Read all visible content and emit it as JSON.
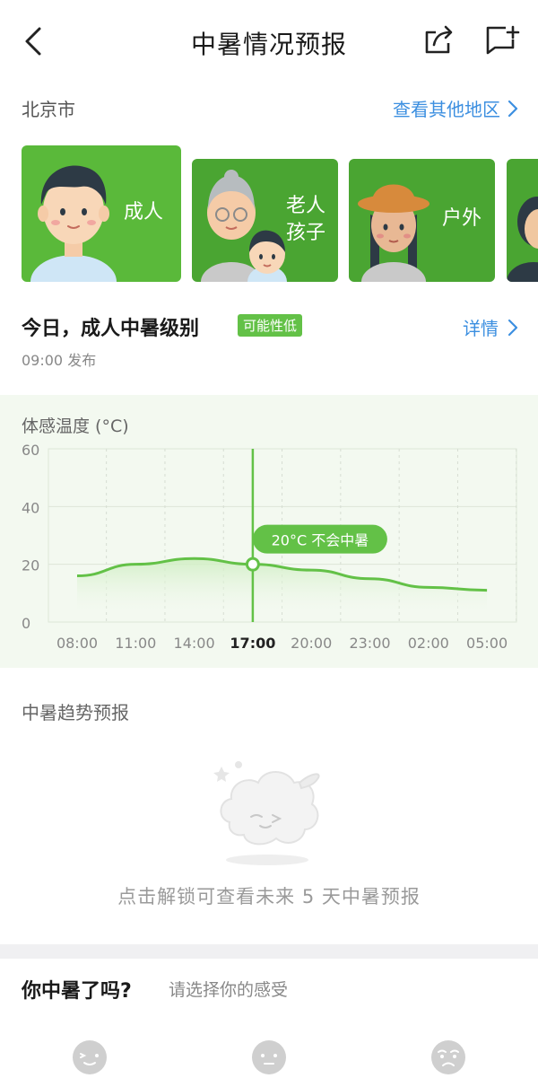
{
  "nav": {
    "title": "中暑情况预报"
  },
  "region": {
    "name": "北京市",
    "other_link": "查看其他地区"
  },
  "groups": [
    {
      "label": "成人",
      "selected": true
    },
    {
      "label1": "老人",
      "label2": "孩子"
    },
    {
      "label": "户外"
    }
  ],
  "today": {
    "title": "今日，成人中暑级别",
    "badge": "可能性低",
    "detail_link": "详情",
    "publish_time": "09:00 发布"
  },
  "chart_data": {
    "type": "line",
    "title": "体感温度 (°C)",
    "categories": [
      "08:00",
      "11:00",
      "14:00",
      "17:00",
      "20:00",
      "23:00",
      "02:00",
      "05:00"
    ],
    "series": [
      {
        "values": [
          16,
          20,
          22,
          20,
          18,
          15,
          12,
          11
        ]
      }
    ],
    "ylim": [
      0,
      60
    ],
    "yticks": [
      0,
      20,
      40,
      60
    ],
    "highlight": {
      "category": "17:00",
      "value": 20,
      "label": "20°C 不会中暑"
    },
    "line_color": "#63c147",
    "grid": true
  },
  "trend": {
    "title": "中暑趋势预报",
    "locked_text": "点击解锁可查看未来 5 天中暑预报"
  },
  "feel": {
    "title": "你中暑了吗?",
    "hint": "请选择你的感受"
  },
  "colors": {
    "accent_green": "#63c147",
    "link_blue": "#3c8fe0",
    "card_green": "#4aa532",
    "card_green_selected": "#5ab93a"
  }
}
